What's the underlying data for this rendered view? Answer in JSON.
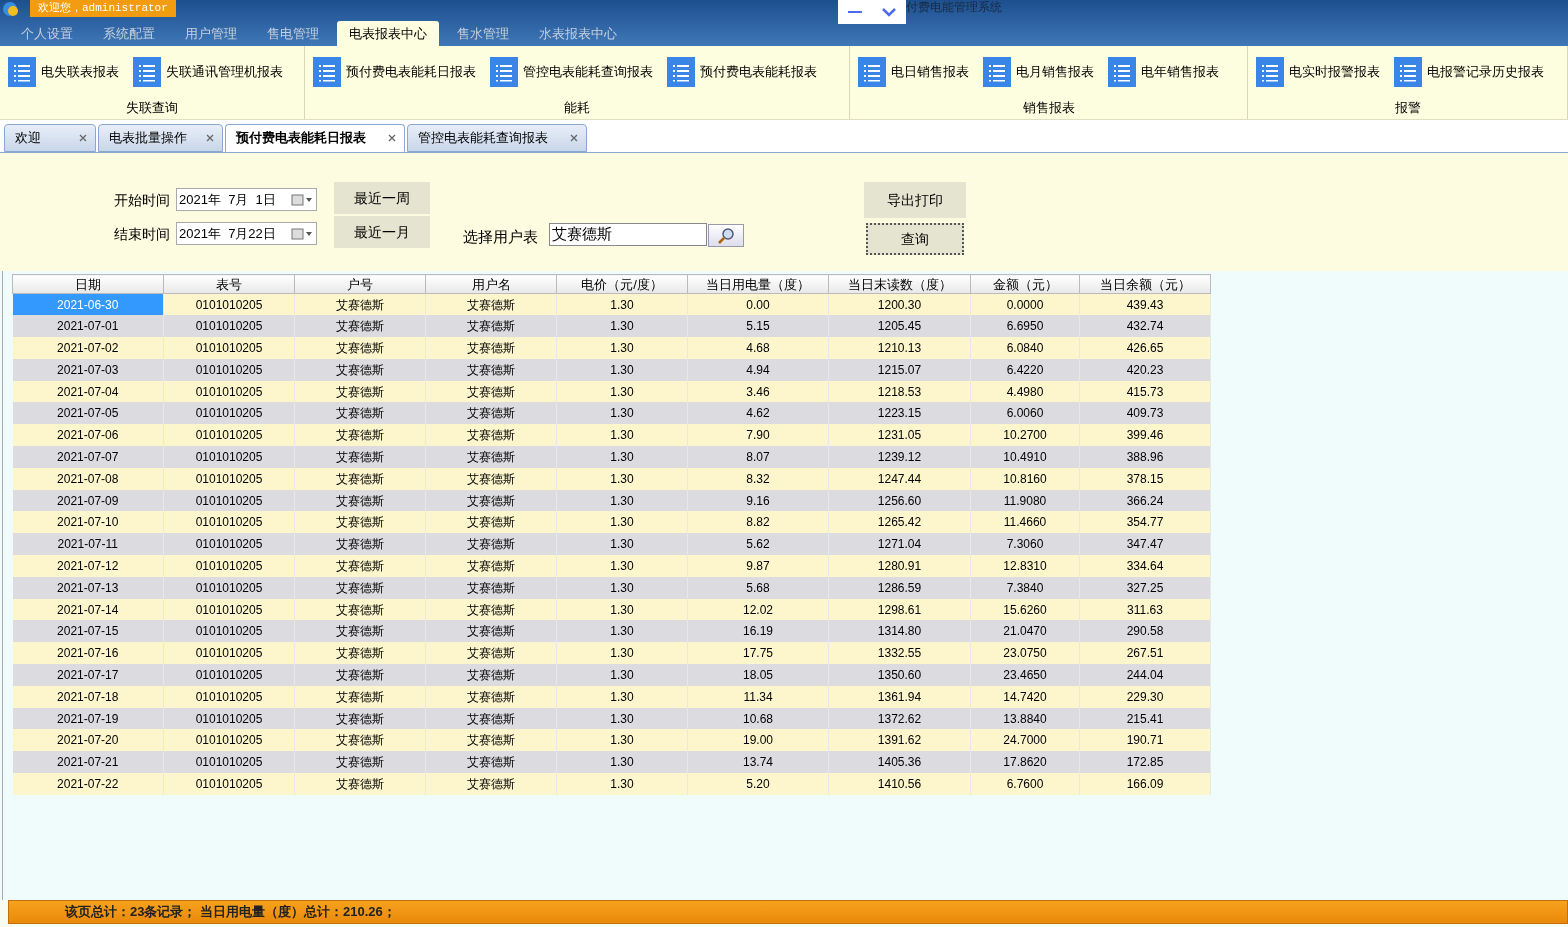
{
  "header": {
    "welcome": "欢迎您，administrator",
    "title": "付费电能管理系统"
  },
  "menu": [
    {
      "label": "个人设置",
      "selected": false
    },
    {
      "label": "系统配置",
      "selected": false
    },
    {
      "label": "用户管理",
      "selected": false
    },
    {
      "label": "售电管理",
      "selected": false
    },
    {
      "label": "电表报表中心",
      "selected": true
    },
    {
      "label": "售水管理",
      "selected": false
    },
    {
      "label": "水表报表中心",
      "selected": false
    }
  ],
  "ribbon": [
    {
      "group": "失联查询",
      "items": [
        "电失联表报表",
        "失联通讯管理机报表"
      ]
    },
    {
      "group": "能耗",
      "items": [
        "预付费电表能耗日报表",
        "管控电表能耗查询报表",
        "预付费电表能耗报表"
      ]
    },
    {
      "group": "销售报表",
      "items": [
        "电日销售报表",
        "电月销售报表",
        "电年销售报表"
      ]
    },
    {
      "group": "报警",
      "items": [
        "电实时报警报表",
        "电报警记录历史报表"
      ]
    }
  ],
  "doc_tabs": [
    {
      "label": "欢迎",
      "selected": false
    },
    {
      "label": "电表批量操作",
      "selected": false
    },
    {
      "label": "预付费电表能耗日报表",
      "selected": true
    },
    {
      "label": "管控电表能耗查询报表",
      "selected": false
    }
  ],
  "filters": {
    "start_label": "开始时间",
    "start_value": "2021年  7月  1日",
    "end_label": "结束时间",
    "end_value": "2021年  7月22日",
    "week_button": "最近一周",
    "month_button": "最近一月",
    "user_label": "选择用户表",
    "user_value": "艾赛德斯",
    "export_button": "导出打印",
    "query_button": "查询"
  },
  "table": {
    "columns": [
      "日期",
      "表号",
      "户号",
      "用户名",
      "电价（元/度）",
      "当日用电量（度）",
      "当日末读数（度）",
      "金额（元）",
      "当日余额（元）"
    ],
    "rows": [
      {
        "selected": true,
        "cells": [
          "2021-06-30",
          "0101010205",
          "艾赛德斯",
          "艾赛德斯",
          "1.30",
          "0.00",
          "1200.30",
          "0.0000",
          "439.43"
        ]
      },
      {
        "selected": false,
        "cells": [
          "2021-07-01",
          "0101010205",
          "艾赛德斯",
          "艾赛德斯",
          "1.30",
          "5.15",
          "1205.45",
          "6.6950",
          "432.74"
        ]
      },
      {
        "selected": false,
        "cells": [
          "2021-07-02",
          "0101010205",
          "艾赛德斯",
          "艾赛德斯",
          "1.30",
          "4.68",
          "1210.13",
          "6.0840",
          "426.65"
        ]
      },
      {
        "selected": false,
        "cells": [
          "2021-07-03",
          "0101010205",
          "艾赛德斯",
          "艾赛德斯",
          "1.30",
          "4.94",
          "1215.07",
          "6.4220",
          "420.23"
        ]
      },
      {
        "selected": false,
        "cells": [
          "2021-07-04",
          "0101010205",
          "艾赛德斯",
          "艾赛德斯",
          "1.30",
          "3.46",
          "1218.53",
          "4.4980",
          "415.73"
        ]
      },
      {
        "selected": false,
        "cells": [
          "2021-07-05",
          "0101010205",
          "艾赛德斯",
          "艾赛德斯",
          "1.30",
          "4.62",
          "1223.15",
          "6.0060",
          "409.73"
        ]
      },
      {
        "selected": false,
        "cells": [
          "2021-07-06",
          "0101010205",
          "艾赛德斯",
          "艾赛德斯",
          "1.30",
          "7.90",
          "1231.05",
          "10.2700",
          "399.46"
        ]
      },
      {
        "selected": false,
        "cells": [
          "2021-07-07",
          "0101010205",
          "艾赛德斯",
          "艾赛德斯",
          "1.30",
          "8.07",
          "1239.12",
          "10.4910",
          "388.96"
        ]
      },
      {
        "selected": false,
        "cells": [
          "2021-07-08",
          "0101010205",
          "艾赛德斯",
          "艾赛德斯",
          "1.30",
          "8.32",
          "1247.44",
          "10.8160",
          "378.15"
        ]
      },
      {
        "selected": false,
        "cells": [
          "2021-07-09",
          "0101010205",
          "艾赛德斯",
          "艾赛德斯",
          "1.30",
          "9.16",
          "1256.60",
          "11.9080",
          "366.24"
        ]
      },
      {
        "selected": false,
        "cells": [
          "2021-07-10",
          "0101010205",
          "艾赛德斯",
          "艾赛德斯",
          "1.30",
          "8.82",
          "1265.42",
          "11.4660",
          "354.77"
        ]
      },
      {
        "selected": false,
        "cells": [
          "2021-07-11",
          "0101010205",
          "艾赛德斯",
          "艾赛德斯",
          "1.30",
          "5.62",
          "1271.04",
          "7.3060",
          "347.47"
        ]
      },
      {
        "selected": false,
        "cells": [
          "2021-07-12",
          "0101010205",
          "艾赛德斯",
          "艾赛德斯",
          "1.30",
          "9.87",
          "1280.91",
          "12.8310",
          "334.64"
        ]
      },
      {
        "selected": false,
        "cells": [
          "2021-07-13",
          "0101010205",
          "艾赛德斯",
          "艾赛德斯",
          "1.30",
          "5.68",
          "1286.59",
          "7.3840",
          "327.25"
        ]
      },
      {
        "selected": false,
        "cells": [
          "2021-07-14",
          "0101010205",
          "艾赛德斯",
          "艾赛德斯",
          "1.30",
          "12.02",
          "1298.61",
          "15.6260",
          "311.63"
        ]
      },
      {
        "selected": false,
        "cells": [
          "2021-07-15",
          "0101010205",
          "艾赛德斯",
          "艾赛德斯",
          "1.30",
          "16.19",
          "1314.80",
          "21.0470",
          "290.58"
        ]
      },
      {
        "selected": false,
        "cells": [
          "2021-07-16",
          "0101010205",
          "艾赛德斯",
          "艾赛德斯",
          "1.30",
          "17.75",
          "1332.55",
          "23.0750",
          "267.51"
        ]
      },
      {
        "selected": false,
        "cells": [
          "2021-07-17",
          "0101010205",
          "艾赛德斯",
          "艾赛德斯",
          "1.30",
          "18.05",
          "1350.60",
          "23.4650",
          "244.04"
        ]
      },
      {
        "selected": false,
        "cells": [
          "2021-07-18",
          "0101010205",
          "艾赛德斯",
          "艾赛德斯",
          "1.30",
          "11.34",
          "1361.94",
          "14.7420",
          "229.30"
        ]
      },
      {
        "selected": false,
        "cells": [
          "2021-07-19",
          "0101010205",
          "艾赛德斯",
          "艾赛德斯",
          "1.30",
          "10.68",
          "1372.62",
          "13.8840",
          "215.41"
        ]
      },
      {
        "selected": false,
        "cells": [
          "2021-07-20",
          "0101010205",
          "艾赛德斯",
          "艾赛德斯",
          "1.30",
          "19.00",
          "1391.62",
          "24.7000",
          "190.71"
        ]
      },
      {
        "selected": false,
        "cells": [
          "2021-07-21",
          "0101010205",
          "艾赛德斯",
          "艾赛德斯",
          "1.30",
          "13.74",
          "1405.36",
          "17.8620",
          "172.85"
        ]
      },
      {
        "selected": false,
        "cells": [
          "2021-07-22",
          "0101010205",
          "艾赛德斯",
          "艾赛德斯",
          "1.30",
          "5.20",
          "1410.56",
          "6.7600",
          "166.09"
        ]
      }
    ]
  },
  "status_bar": "该页总计：23条记录；  当日用电量（度）总计：210.26；"
}
